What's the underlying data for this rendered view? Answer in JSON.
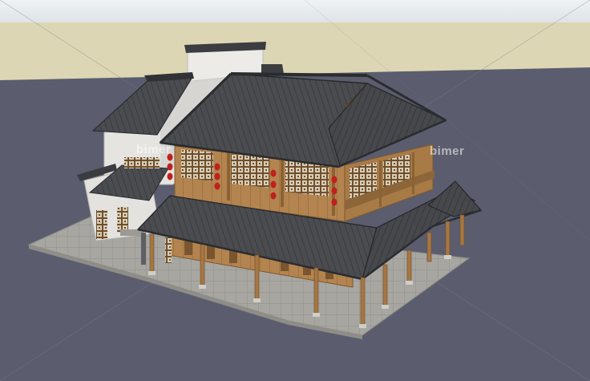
{
  "watermark": {
    "text": "bimer",
    "color": "#ffffff"
  },
  "colors": {
    "sky_top": "#e9eef1",
    "sky_bottom": "#dfe5e8",
    "horizon": "#dcd6b4",
    "ground": "#5b5d6e",
    "plaza": "#a9a8a3",
    "roof": "#4b4d50",
    "roof_dark": "#35373a",
    "wall_white": "#e8e8e6",
    "wood": "#b0834f",
    "wood_dark": "#8a6234",
    "lantern": "#c0201e"
  }
}
